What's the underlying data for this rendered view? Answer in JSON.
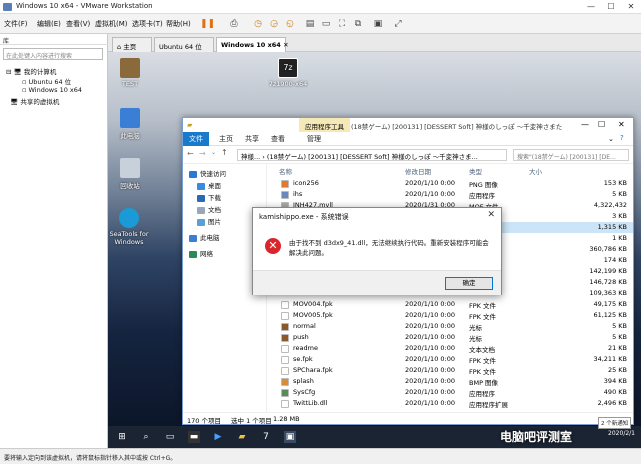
{
  "vmware": {
    "title": "Windows 10 x64 - VMware Workstation",
    "menu": [
      "文件(F)",
      "编辑(E)",
      "查看(V)",
      "虚拟机(M)",
      "选项卡(T)",
      "帮助(H)"
    ]
  },
  "library": {
    "header": "库",
    "search_placeholder": "在此处键入内容进行搜索",
    "my_computer": "我的计算机",
    "vm1": "Ubuntu 64 位",
    "vm2": "Windows 10 x64",
    "shared": "共享的虚拟机"
  },
  "vm_tabs": [
    "主页",
    "Ubuntu 64 位",
    "Windows 10 x64"
  ],
  "desktop_icons": [
    "TEST",
    "7z1900-x64",
    "此电脑",
    "回收站",
    "SeaTools for Windows"
  ],
  "explorer": {
    "context_tab": "应用程序工具",
    "title": "(18禁ゲーム) [200131] [DESSERT Soft] 神様のしっぽ ～千変神さまたちの...",
    "ribbon": [
      "文件",
      "主页",
      "共享",
      "查看",
      "管理"
    ],
    "address": "神様... › (18禁ゲーム) [200131] [DESSERT Soft] 神様のしっぽ ～千変神さま...",
    "search_placeholder": "搜索\"(18禁ゲーム) [200131] [DE...",
    "nav": [
      "快速访问",
      "桌面",
      "下载",
      "文档",
      "图片",
      "此电脑",
      "网络"
    ],
    "columns": [
      "名称",
      "修改日期",
      "类型",
      "大小"
    ],
    "files": [
      {
        "name": "icon256",
        "date": "2020/1/10 0:00",
        "type": "PNG 图像",
        "size": "153 KB",
        "color": "#e07a2e"
      },
      {
        "name": "ihs",
        "date": "2020/1/10 0:00",
        "type": "应用程序",
        "size": "5 KB",
        "color": "#6a88c0"
      },
      {
        "name": "INH427.mvll",
        "date": "2020/1/31 0:00",
        "type": "MOF 文件",
        "size": "4,322,432",
        "color": "#aaaaaa"
      },
      {
        "name": "",
        "date": "",
        "type": "",
        "size": "3 KB",
        "color": ""
      },
      {
        "name": "",
        "date": "",
        "type": "",
        "size": "1,315 KB",
        "color": ""
      },
      {
        "name": "",
        "date": "",
        "type": "",
        "size": "1 KB",
        "color": ""
      },
      {
        "name": "",
        "date": "",
        "type": "",
        "size": "360,786 KB",
        "color": ""
      },
      {
        "name": "",
        "date": "",
        "type": "",
        "size": "174 KB",
        "color": ""
      },
      {
        "name": "",
        "date": "",
        "type": "",
        "size": "142,199 KB",
        "color": ""
      },
      {
        "name": "",
        "date": "",
        "type": "",
        "size": "146,728 KB",
        "color": ""
      },
      {
        "name": "",
        "date": "",
        "type": "",
        "size": "109,363 KB",
        "color": ""
      },
      {
        "name": "MOV004.fpk",
        "date": "2020/1/10 0:00",
        "type": "FPK 文件",
        "size": "49,175 KB",
        "color": "#ffffff"
      },
      {
        "name": "MOV005.fpk",
        "date": "2020/1/10 0:00",
        "type": "FPK 文件",
        "size": "61,125 KB",
        "color": "#ffffff"
      },
      {
        "name": "normal",
        "date": "2020/1/10 0:00",
        "type": "光标",
        "size": "5 KB",
        "color": "#8b5a2b"
      },
      {
        "name": "push",
        "date": "2020/1/10 0:00",
        "type": "光标",
        "size": "5 KB",
        "color": "#8b5a2b"
      },
      {
        "name": "readme",
        "date": "2020/1/10 0:00",
        "type": "文本文档",
        "size": "21 KB",
        "color": "#ffffff"
      },
      {
        "name": "se.fpk",
        "date": "2020/1/10 0:00",
        "type": "FPK 文件",
        "size": "34,211 KB",
        "color": "#ffffff"
      },
      {
        "name": "SPChara.fpk",
        "date": "2020/1/10 0:00",
        "type": "FPK 文件",
        "size": "25 KB",
        "color": "#ffffff"
      },
      {
        "name": "splash",
        "date": "2020/1/10 0:00",
        "type": "BMP 图像",
        "size": "394 KB",
        "color": "#d98c3a"
      },
      {
        "name": "SysCfg",
        "date": "2020/1/10 0:00",
        "type": "应用程序",
        "size": "490 KB",
        "color": "#5b8a5b"
      },
      {
        "name": "TwittLib.dll",
        "date": "2020/1/10 0:00",
        "type": "应用程序扩展",
        "size": "2,496 KB",
        "color": "#ffffff"
      }
    ],
    "status": {
      "count": "170 个项目",
      "selected": "选中 1 个项目",
      "size": "1.28 MB"
    }
  },
  "dialog": {
    "title": "kamishippo.exe - 系统错误",
    "message": "由于找不到 d3dx9_41.dll，无法继续执行代码。重新安装程序可能会解决此问题。",
    "ok": "确定"
  },
  "guest_tray": {
    "notify": "2 个新通知",
    "date": "2020/2/1"
  },
  "status_text": "要将输入定向到该虚拟机，请将鼠标指针移入其中或按 Ctrl+G。",
  "watermark": "电脑吧评测室"
}
